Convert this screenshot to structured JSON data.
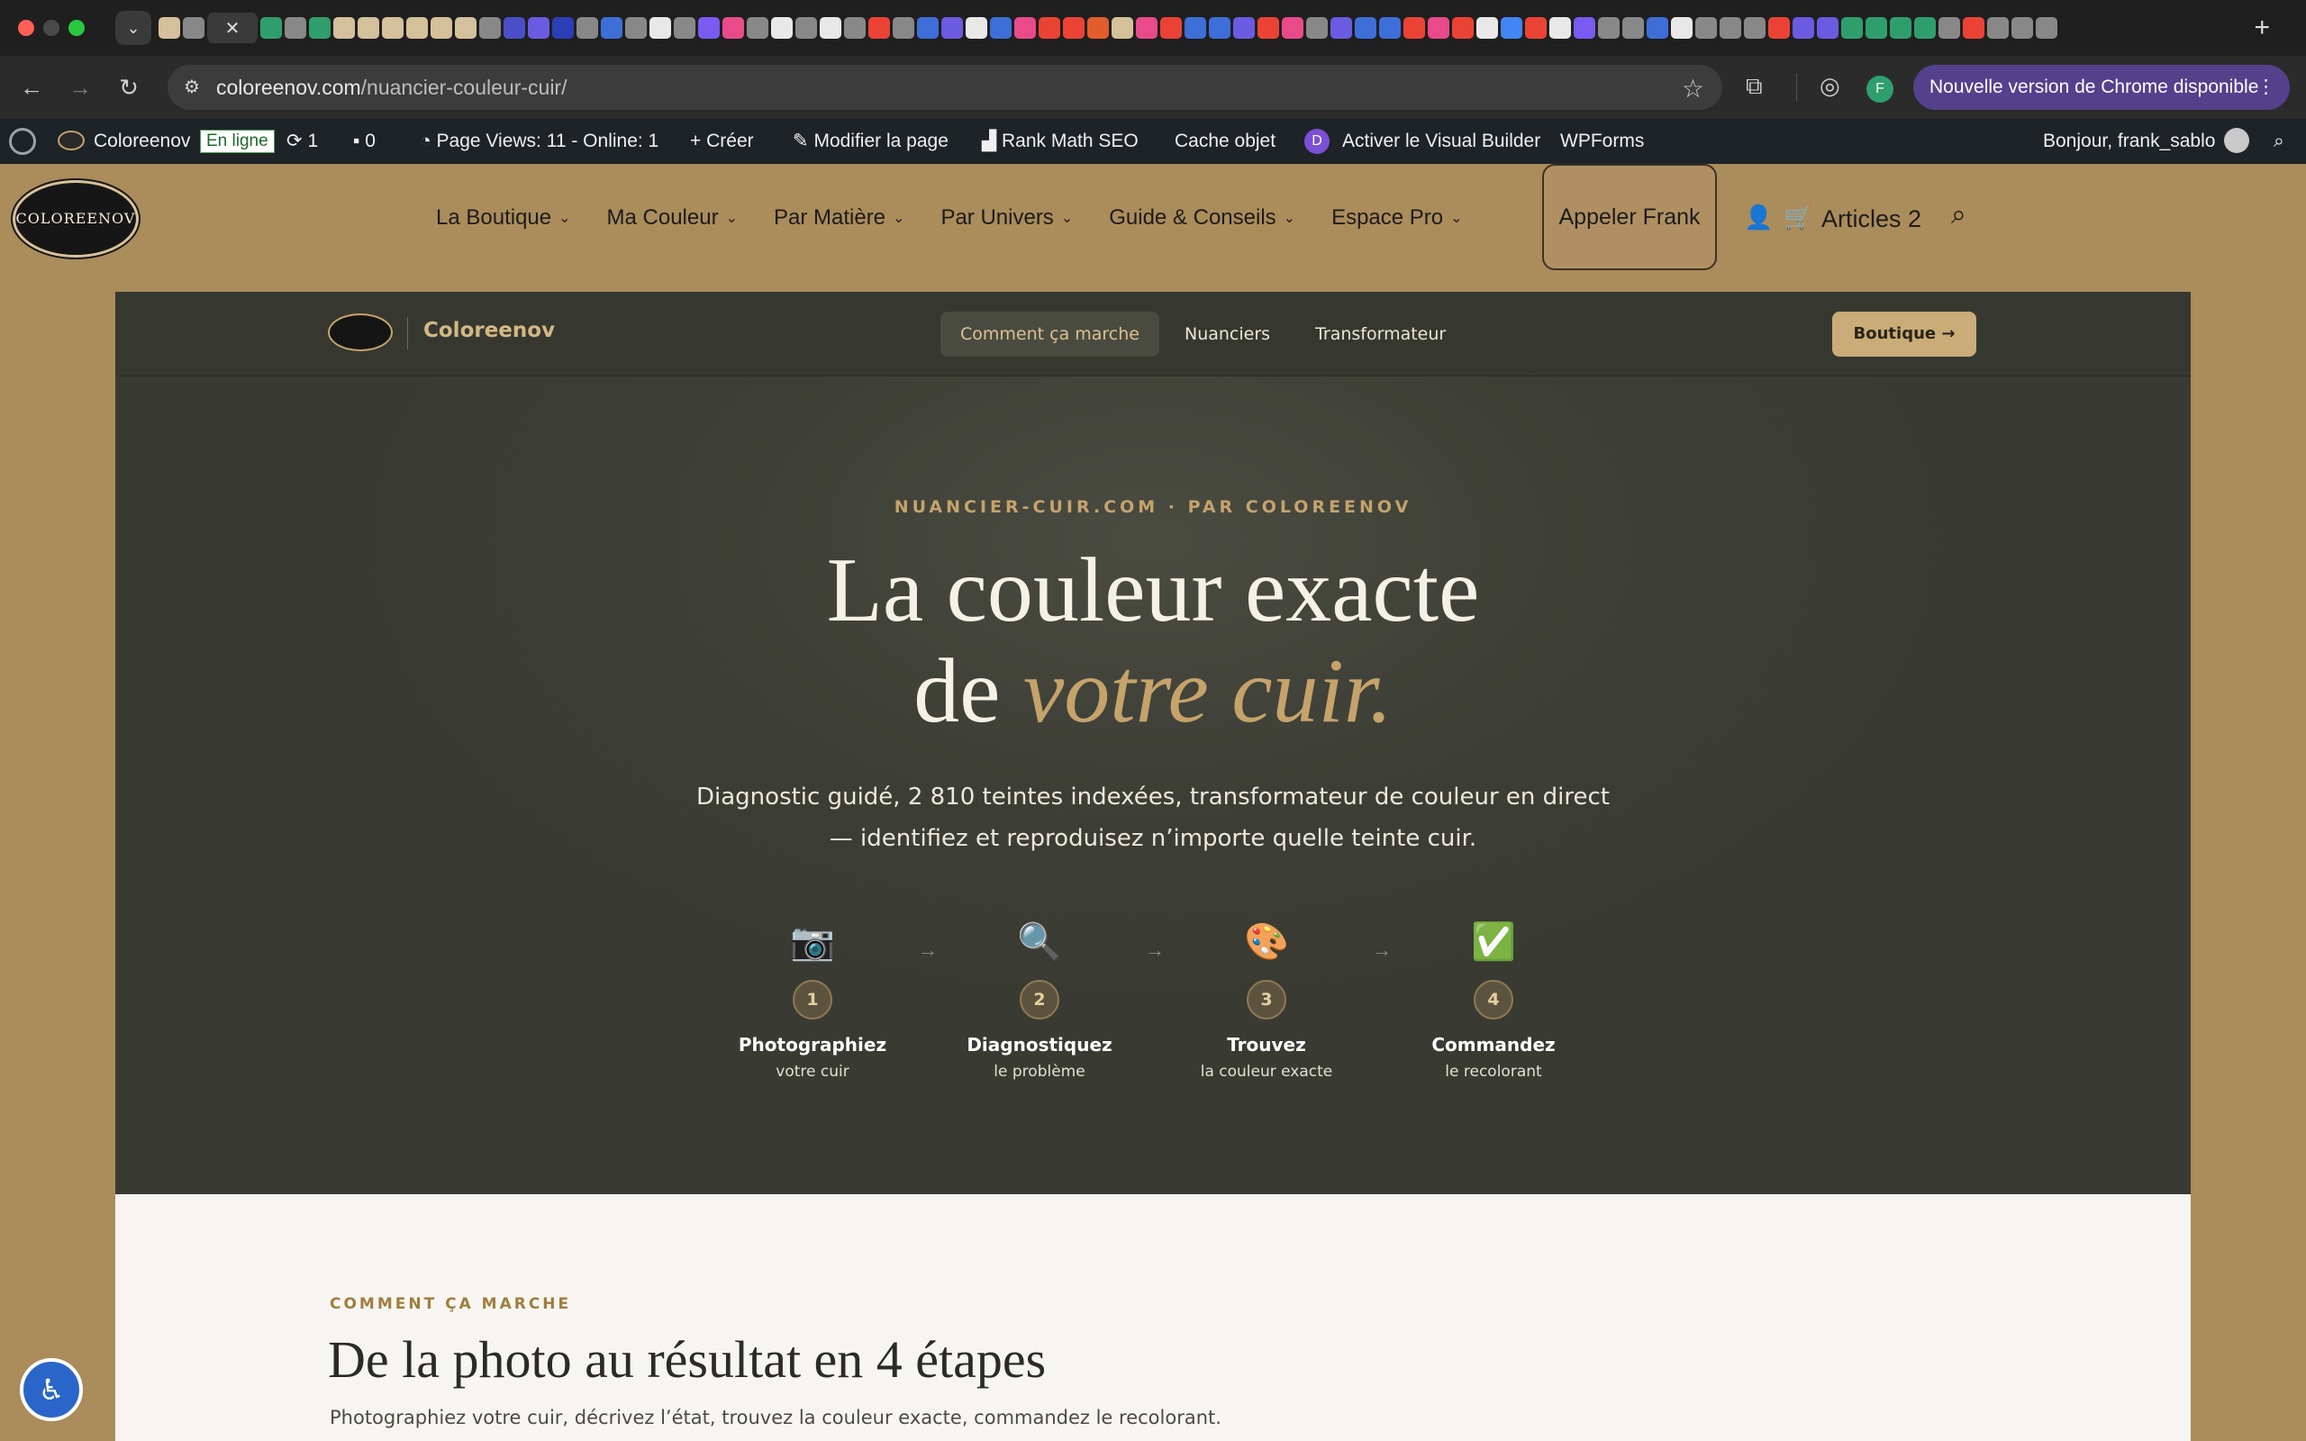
{
  "browser": {
    "url_host": "coloreenov.com",
    "url_path": "/nuancier-couleur-cuir/",
    "update_label": "Nouvelle version de Chrome disponible",
    "profile_initial": "F",
    "tab_favicon_colors": [
      "#d4c09a",
      "#888",
      "#2f9e6d",
      "#888",
      "#2f9e6d",
      "#d4c09a",
      "#d4c09a",
      "#d4c09a",
      "#d4c09a",
      "#d4c09a",
      "#d4c09a",
      "#888",
      "#4b4fc7",
      "#6b5be0",
      "#2a3fb5",
      "#888",
      "#3e6fd8",
      "#888",
      "#e8e8e8",
      "#888",
      "#7a5af0",
      "#e84a8a",
      "#888",
      "#e8e8e8",
      "#888",
      "#e8e8e8",
      "#888",
      "#ea4335",
      "#888",
      "#3e6fd8",
      "#6b5be0",
      "#e8e8e8",
      "#3e6fd8",
      "#e84a8a",
      "#ea4335",
      "#ea4335",
      "#e35c2b",
      "#d4c09a",
      "#e84a8a",
      "#ea4335",
      "#3e6fd8",
      "#3e6fd8",
      "#6b5be0",
      "#ea4335",
      "#e84a8a",
      "#888",
      "#6b5be0",
      "#3e6fd8",
      "#3e6fd8",
      "#ea4335",
      "#e84a8a",
      "#ea4335",
      "#e8e8e8",
      "#4285f4",
      "#ea4335",
      "#e8e8e8",
      "#7a5af0",
      "#888",
      "#888",
      "#3e6fd8",
      "#e8e8e8",
      "#888",
      "#888",
      "#888",
      "#ea4335",
      "#6b5be0",
      "#6b5be0",
      "#2f9e6d",
      "#2f9e6d",
      "#2f9e6d",
      "#2f9e6d",
      "#888",
      "#ea4335",
      "#888",
      "#888",
      "#888"
    ]
  },
  "wpbar": {
    "site_name": "Coloreenov",
    "status_badge": "En ligne",
    "updates_count": "1",
    "comments_count": "0",
    "page_views": "Page Views: 11 - Online: 1",
    "create_label": "Créer",
    "edit_label": "Modifier la page",
    "seo_label": "Rank Math SEO",
    "cache_label": "Cache objet",
    "vb_label": "Activer le Visual Builder",
    "vb_icon_letter": "D",
    "forms_label": "WPForms",
    "greeting": "Bonjour, frank_sablo"
  },
  "site_header": {
    "logo_text": "COLOREENOV",
    "nav": [
      "La Boutique",
      "Ma Couleur",
      "Par Matière",
      "Par Univers",
      "Guide & Conseils",
      "Espace Pro"
    ],
    "call_label": "Appeler Frank",
    "cart_label": "Articles 2"
  },
  "app": {
    "brand": "Coloreenov",
    "links": [
      "Comment ça marche",
      "Nuanciers",
      "Transformateur"
    ],
    "shop_label": "Boutique →"
  },
  "hero": {
    "eyebrow": "NUANCIER-CUIR.COM · PAR COLOREENOV",
    "title_line1": "La couleur exacte",
    "title_line2_plain": "de ",
    "title_line2_em": "votre cuir.",
    "sub_line1": "Diagnostic guidé, 2 810 teintes indexées, transformateur de couleur en direct",
    "sub_line2": "— identifiez et reproduisez n’importe quelle teinte cuir.",
    "steps": [
      {
        "emoji": "📷",
        "num": "1",
        "title": "Photographiez",
        "desc": "votre cuir"
      },
      {
        "emoji": "🔍",
        "num": "2",
        "title": "Diagnostiquez",
        "desc": "le problème"
      },
      {
        "emoji": "🎨",
        "num": "3",
        "title": "Trouvez",
        "desc": "la couleur exacte"
      },
      {
        "emoji": "✅",
        "num": "4",
        "title": "Commandez",
        "desc": "le recolorant"
      }
    ]
  },
  "how": {
    "eyebrow": "COMMENT ÇA MARCHE",
    "title": "De la photo au résultat en 4 étapes",
    "text": "Photographiez votre cuir, décrivez l’état, trouvez la couleur exacte, commandez le recolorant."
  }
}
